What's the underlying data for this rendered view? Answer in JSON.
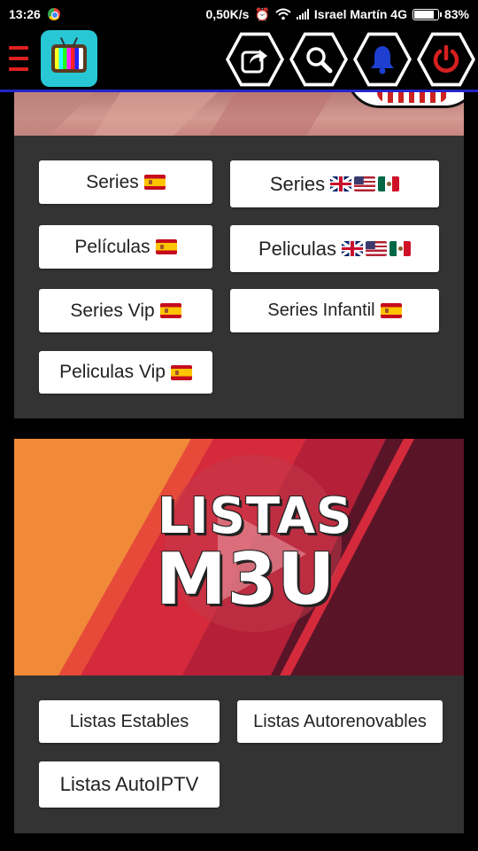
{
  "status_bar": {
    "time": "13:26",
    "speed": "0,50K/s",
    "carrier": "Israel Martín 4G",
    "battery": "83%",
    "battery_level": 0.83
  },
  "toolbar": {
    "menu_icon": "hamburger-icon",
    "logo_icon": "retro-tv-icon",
    "actions": [
      {
        "name": "share",
        "icon": "share-icon",
        "color": "#ffffff"
      },
      {
        "name": "search",
        "icon": "search-icon",
        "color": "#ffffff"
      },
      {
        "name": "notifications",
        "icon": "bell-icon",
        "color": "#1e3fd0"
      },
      {
        "name": "power",
        "icon": "power-icon",
        "color": "#d62020"
      }
    ],
    "accent_line_color": "#2424c8"
  },
  "section1": {
    "buttons": [
      {
        "label": "Series",
        "flags": [
          "es"
        ]
      },
      {
        "label": "Series",
        "flags": [
          "uk",
          "us",
          "mx"
        ]
      },
      {
        "label": "Películas",
        "flags": [
          "es"
        ]
      },
      {
        "label": "Peliculas",
        "flags": [
          "uk",
          "us",
          "mx"
        ]
      },
      {
        "label": "Series Vip",
        "flags": [
          "es"
        ]
      },
      {
        "label": "Series Infantil",
        "flags": [
          "es"
        ]
      },
      {
        "label": "Peliculas Vip",
        "flags": [
          "es"
        ]
      }
    ]
  },
  "m3u_banner": {
    "line1": "LISTAS",
    "line2": "M3U"
  },
  "section2": {
    "buttons": [
      {
        "label": "Listas Estables"
      },
      {
        "label": "Listas Autorenovables"
      },
      {
        "label": "Listas AutoIPTV"
      }
    ]
  }
}
